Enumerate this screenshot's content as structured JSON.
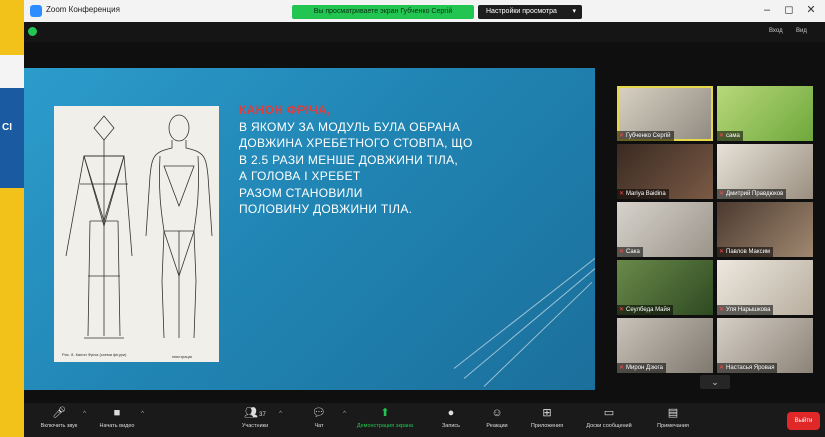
{
  "window": {
    "title": "Zoom Конференция",
    "controls": {
      "minimize": "–",
      "maximize": "◻",
      "close": "✕"
    }
  },
  "share_banner": {
    "viewing_text": "Вы просматриваете экран Губченко Сергій",
    "view_options": "Настройки просмотра",
    "caret": "▾"
  },
  "meeting_bar": {
    "view_label": "Вход",
    "exit_label": "Вид"
  },
  "left_desktop": {
    "text": "СІ"
  },
  "slide": {
    "heading": "КАНОН ФРІЧА,",
    "lines": [
      "В ЯКОМУ ЗА МОДУЛЬ БУЛА ОБРАНА",
      "ДОВЖИНА ХРЕБЕТНОГО СТОВПА, ЩО",
      "В 2.5 РАЗИ МЕНШЕ ДОВЖИНИ ТІЛА,",
      "А ГОЛОВА І ХРЕБЕТ",
      "РАЗОМ СТАНОВИЛИ",
      "ПОЛОВИНУ ДОВЖИНИ ТІЛА."
    ],
    "figure_caption": "Рис. 8. Канон Фріча (схема фігури)",
    "figure_caption_right": "ілюстрація",
    "colors": {
      "heading": "#e43b3b",
      "text": "#ffffff",
      "background": "#2186b5"
    }
  },
  "participants": [
    {
      "name": "Губченко Сергій",
      "active": true
    },
    {
      "name": "сама"
    },
    {
      "name": "Mariya Baidina"
    },
    {
      "name": "Дмитрий Правдюков"
    },
    {
      "name": "Сака"
    },
    {
      "name": "Павлов Максим"
    },
    {
      "name": "Сеулбеда Майя"
    },
    {
      "name": "Уля Нарышкова"
    },
    {
      "name": "Мирон Дзюга"
    },
    {
      "name": "Настасья Яровая"
    }
  ],
  "gallery_down": "⌄",
  "toolbar": {
    "mute": "Включить звук",
    "video": "Начать видео",
    "participants": "Участники",
    "participants_count": "37",
    "chat": "Чат",
    "share": "Демонстрация экрана",
    "record": "Запись",
    "reactions": "Реакции",
    "apps": "Приложения",
    "whiteboard": "Доски сообщений",
    "notes": "Примечания",
    "end": "Выйти"
  }
}
